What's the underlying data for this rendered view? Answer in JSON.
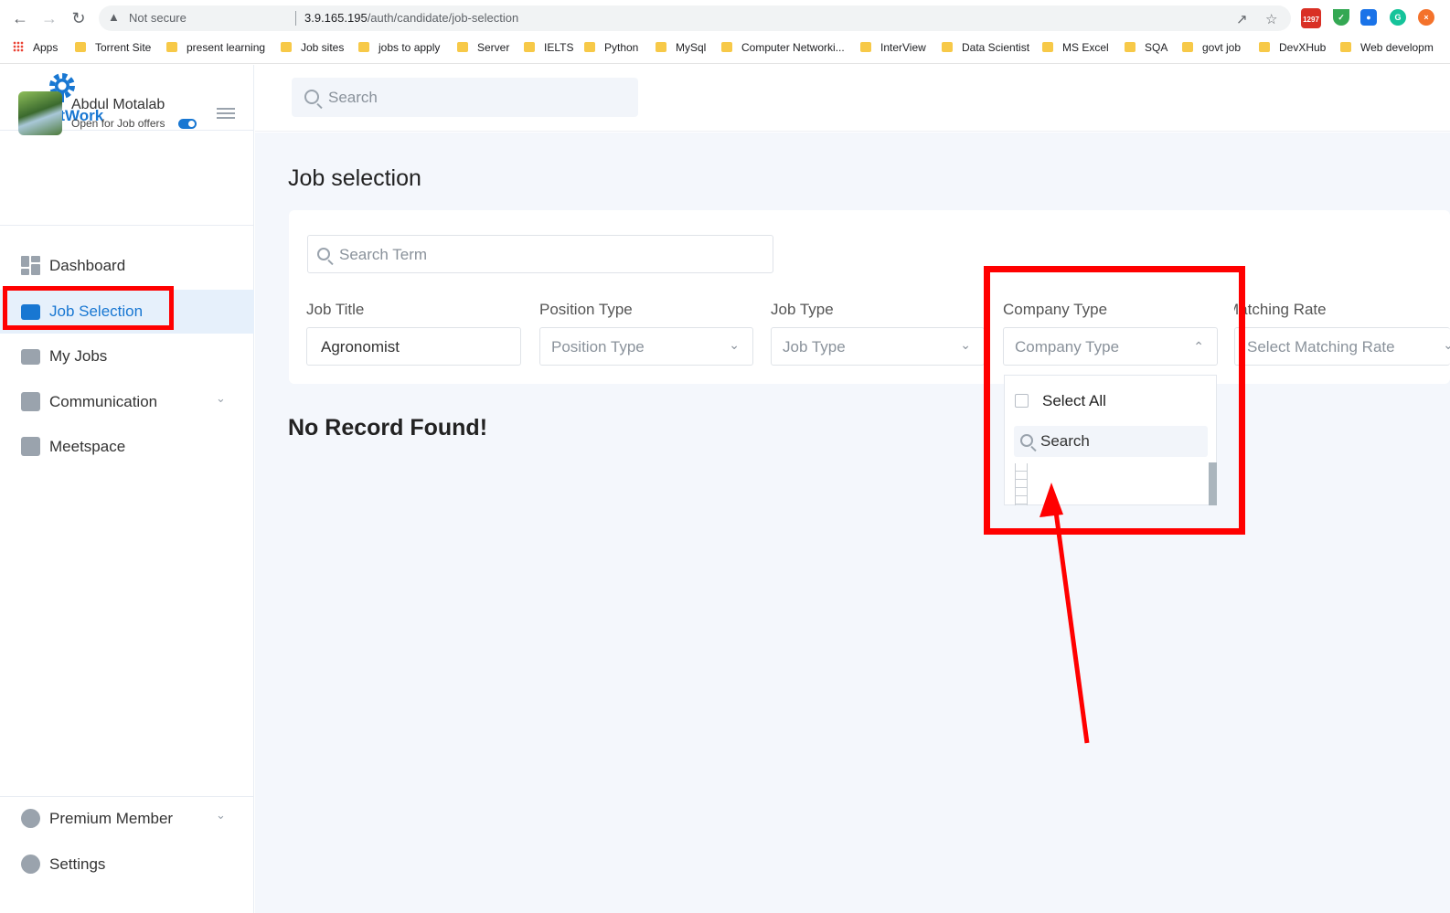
{
  "browser": {
    "security_label": "Not secure",
    "url_host": "3.9.165.195",
    "url_path": "/auth/candidate/job-selection",
    "extension_badge": "1297",
    "bookmarks": [
      "Apps",
      "Torrent Site",
      "present learning",
      "Job sites",
      "jobs to apply",
      "Server",
      "IELTS",
      "Python",
      "MySql",
      "Computer Networki...",
      "InterView",
      "Data Scientist",
      "MS Excel",
      "SQA",
      "govt job",
      "DevXHub",
      "Web developm"
    ]
  },
  "brand": {
    "name": "SmartWork",
    "color": "#1877d2"
  },
  "profile": {
    "name": "Abdul Motalab",
    "status": "Open for Job offers",
    "open_for_offers": true
  },
  "sidebar": {
    "items": [
      {
        "label": "Dashboard",
        "icon": "dashboard-icon"
      },
      {
        "label": "Job Selection",
        "icon": "briefcase-icon",
        "active": true
      },
      {
        "label": "My Jobs",
        "icon": "bag-icon"
      },
      {
        "label": "Communication",
        "icon": "chat-icon",
        "has_submenu": true
      },
      {
        "label": "Meetspace",
        "icon": "meet-icon"
      }
    ],
    "bottom_items": [
      {
        "label": "Premium Member",
        "icon": "badge-icon",
        "has_submenu": true
      },
      {
        "label": "Settings",
        "icon": "gear-icon"
      }
    ]
  },
  "topbar": {
    "search_placeholder": "Search"
  },
  "main": {
    "title": "Job selection",
    "search_term_placeholder": "Search Term",
    "filters": {
      "job_title": {
        "label": "Job Title",
        "value": "Agronomist"
      },
      "position_type": {
        "label": "Position Type",
        "placeholder": "Position Type"
      },
      "job_type": {
        "label": "Job Type",
        "placeholder": "Job Type"
      },
      "company_type": {
        "label": "Company Type",
        "placeholder": "Company Type",
        "open": true
      },
      "matching_rate": {
        "label": "Matching Rate",
        "placeholder": "Select Matching Rate"
      }
    },
    "empty_message": "No Record Found!"
  },
  "company_dropdown": {
    "select_all_label": "Select All",
    "search_placeholder": "Search"
  },
  "annotation_color": "#ff0000"
}
